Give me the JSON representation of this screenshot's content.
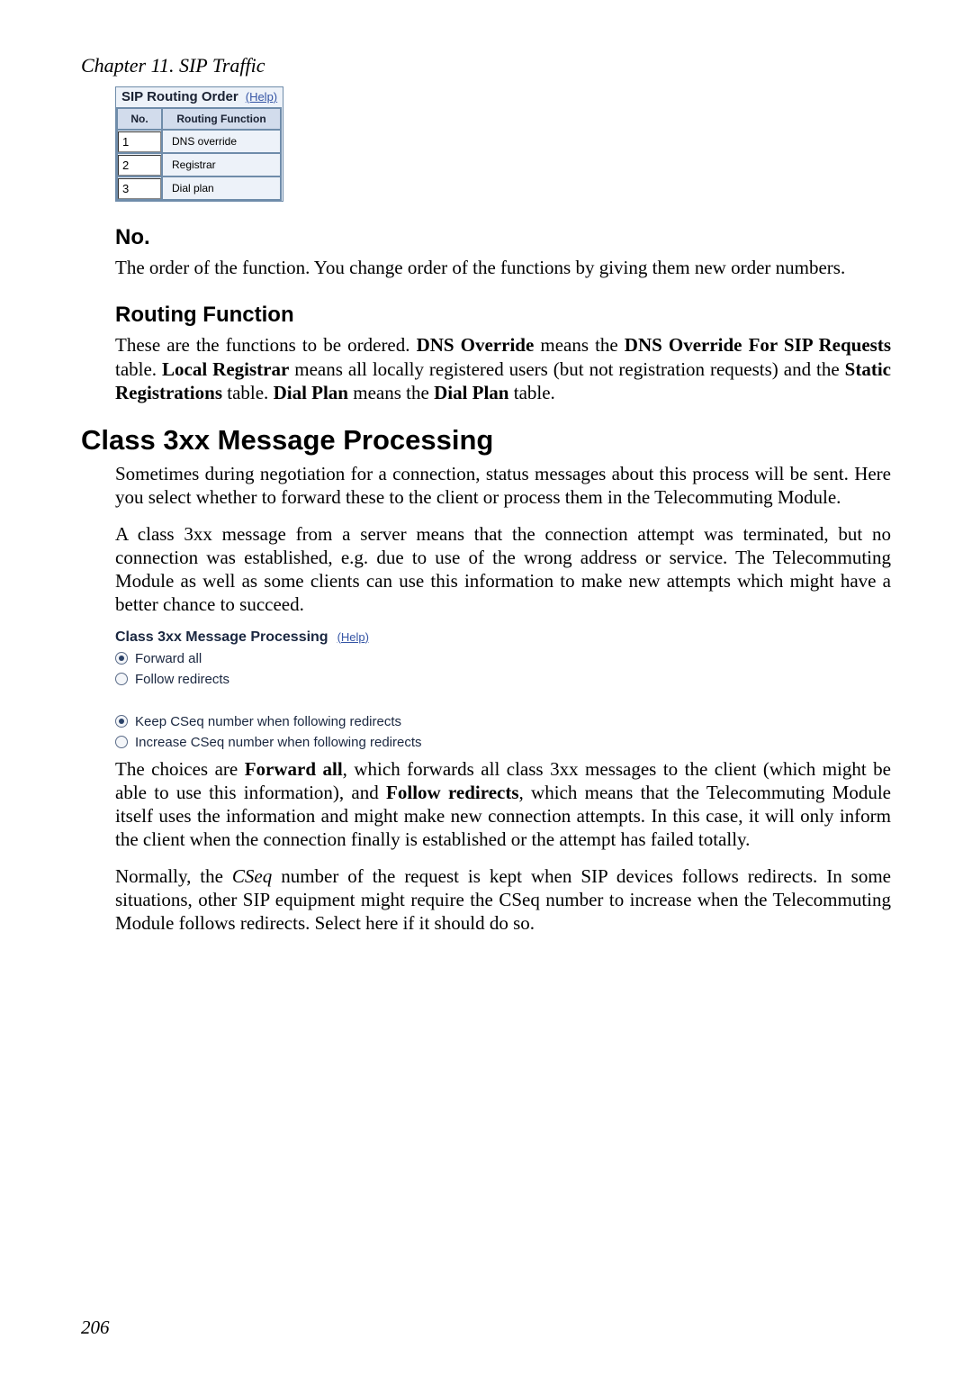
{
  "chapter_header": "Chapter 11. SIP Traffic",
  "tablefig": {
    "title": "SIP Routing Order",
    "help": "(Help)",
    "col_no": "No.",
    "col_func": "Routing Function",
    "rows": [
      {
        "no": "1",
        "func": "DNS override"
      },
      {
        "no": "2",
        "func": "Registrar"
      },
      {
        "no": "3",
        "func": "Dial plan"
      }
    ]
  },
  "no_heading": "No.",
  "no_para": "The order of the function. You change order of the functions by giving them new order numbers.",
  "routing_heading": "Routing Function",
  "routing_para_parts": {
    "p1": "These are the functions to be ordered. ",
    "b1": "DNS Override",
    "p2": " means the ",
    "b2": "DNS Override For SIP Requests",
    "p3": " table. ",
    "b3": "Local Registrar",
    "p4": " means all locally registered users (but not registration requests) and the ",
    "b4": "Static Registrations",
    "p5": " table. ",
    "b5": "Dial Plan",
    "p6": " means the ",
    "b6": "Dial Plan",
    "p7": " table."
  },
  "class3xx_heading": "Class 3xx Message Processing",
  "class3xx_p1": "Sometimes during negotiation for a connection, status messages about this process will be sent. Here you select whether to forward these to the client or process them in the Telecommuting Module.",
  "class3xx_p2": "A class 3xx message from a server means that the connection attempt was terminated, but no connection was established, e.g. due to use of the wrong address or service. The Telecommuting Module as well as some clients can use this information to make new attempts which might have a better chance to succeed.",
  "msgfig": {
    "title": "Class 3xx Message Processing",
    "help": "(Help)",
    "opt_forward": "Forward all",
    "opt_follow": "Follow redirects",
    "opt_keep": "Keep CSeq number when following redirects",
    "opt_increase": "Increase CSeq number when following redirects"
  },
  "choices_para": {
    "p1": "The choices are ",
    "b1": "Forward all",
    "p2": ", which forwards all class 3xx messages to the client (which might be able to use this information), and ",
    "b2": "Follow redirects",
    "p3": ", which means that the Telecommuting Module itself uses the information and might make new connection attempts. In this case, it will only inform the client when the connection finally is established or the attempt has failed totally."
  },
  "cseq_para": {
    "p1": "Normally, the ",
    "i1": "CSeq",
    "p2": " number of the request is kept when SIP devices follows redirects. In some situations, other SIP equipment might require the CSeq number to increase when the Telecommuting Module follows redirects. Select here if it should do so."
  },
  "page_number": "206"
}
